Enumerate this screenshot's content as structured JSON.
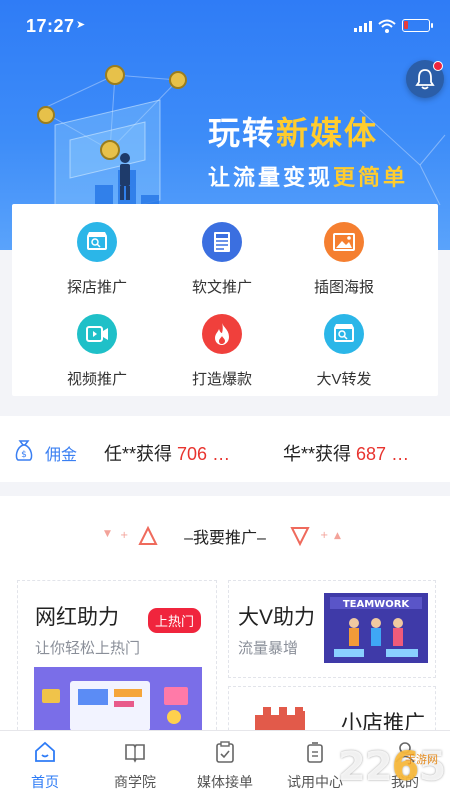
{
  "status_bar": {
    "time": "17:27"
  },
  "hero": {
    "slogan_part1": "玩转",
    "slogan_part1_hl": "新媒体",
    "slogan2_part1": "让流量变现",
    "slogan2_hl": "更简单"
  },
  "categories": [
    {
      "label": "探店推广",
      "icon": "store-search-icon",
      "color": "#2bb6e8"
    },
    {
      "label": "软文推广",
      "icon": "news-icon",
      "color": "#3b6fe0"
    },
    {
      "label": "插图海报",
      "icon": "image-icon",
      "color": "#f57f30"
    },
    {
      "label": "视频推广",
      "icon": "video-icon",
      "color": "#1fc0c8"
    },
    {
      "label": "打造爆款",
      "icon": "fire-icon",
      "color": "#f0403c"
    },
    {
      "label": "大V转发",
      "icon": "store-search-icon",
      "color": "#2bb6e8"
    }
  ],
  "ticker": {
    "label": "佣金",
    "items": [
      {
        "user": "任**获得",
        "amount": "706 …"
      },
      {
        "user": "华**获得",
        "amount": "687 …"
      }
    ]
  },
  "promote": {
    "heading": "–我要推广–",
    "cards": [
      {
        "title": "网红助力",
        "badge": "上热门",
        "subtitle": "让你轻松上热门"
      },
      {
        "title": "大V助力",
        "subtitle": "流量暴增",
        "image_text": "TEAMWORK"
      },
      {
        "title": "小店推广"
      }
    ]
  },
  "tabs": [
    {
      "label": "首页",
      "icon": "home-icon"
    },
    {
      "label": "商学院",
      "icon": "book-icon"
    },
    {
      "label": "媒体接单",
      "icon": "clipboard-icon"
    },
    {
      "label": "试用中心",
      "icon": "trial-icon"
    },
    {
      "label": "我的",
      "icon": "user-icon"
    }
  ],
  "watermark": {
    "main_a": "22",
    "main_o": "6",
    "main_b": "5",
    "sub": "手游网"
  },
  "colors": {
    "primary": "#2f7cf6",
    "accent_red": "#e8342f",
    "hot_badge": "#f0253d"
  }
}
